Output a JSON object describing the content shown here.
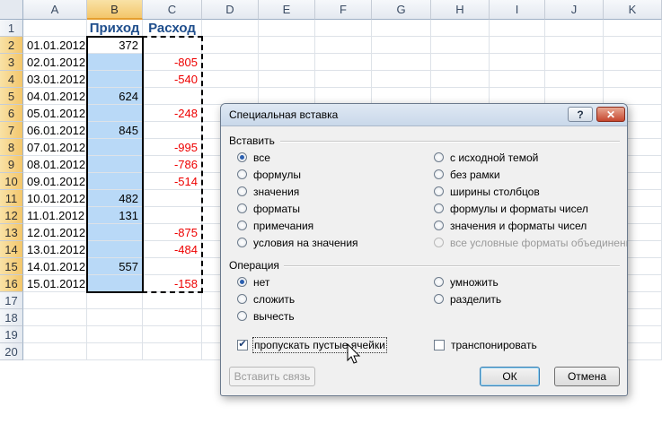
{
  "columns": [
    "A",
    "B",
    "C",
    "D",
    "E",
    "F",
    "G",
    "H",
    "I",
    "J",
    "K"
  ],
  "rows": [
    "1",
    "2",
    "3",
    "4",
    "5",
    "6",
    "7",
    "8",
    "9",
    "10",
    "11",
    "12",
    "13",
    "14",
    "15",
    "16",
    "17",
    "18",
    "19",
    "20"
  ],
  "headers": {
    "income": "Приход",
    "expense": "Расход"
  },
  "data": [
    {
      "date": "01.01.2012",
      "income": "372",
      "expense": ""
    },
    {
      "date": "02.01.2012",
      "income": "",
      "expense": "-805"
    },
    {
      "date": "03.01.2012",
      "income": "",
      "expense": "-540"
    },
    {
      "date": "04.01.2012",
      "income": "624",
      "expense": ""
    },
    {
      "date": "05.01.2012",
      "income": "",
      "expense": "-248"
    },
    {
      "date": "06.01.2012",
      "income": "845",
      "expense": ""
    },
    {
      "date": "07.01.2012",
      "income": "",
      "expense": "-995"
    },
    {
      "date": "08.01.2012",
      "income": "",
      "expense": "-786"
    },
    {
      "date": "09.01.2012",
      "income": "",
      "expense": "-514"
    },
    {
      "date": "10.01.2012",
      "income": "482",
      "expense": ""
    },
    {
      "date": "11.01.2012",
      "income": "131",
      "expense": ""
    },
    {
      "date": "12.01.2012",
      "income": "",
      "expense": "-875"
    },
    {
      "date": "13.01.2012",
      "income": "",
      "expense": "-484"
    },
    {
      "date": "14.01.2012",
      "income": "557",
      "expense": ""
    },
    {
      "date": "15.01.2012",
      "income": "",
      "expense": "-158"
    }
  ],
  "dialog": {
    "title": "Специальная вставка",
    "help_label": "?",
    "close_label": "✕",
    "paste_section": "Вставить",
    "paste_left": [
      {
        "label": "все",
        "checked": true
      },
      {
        "label": "формулы",
        "checked": false
      },
      {
        "label": "значения",
        "checked": false
      },
      {
        "label": "форматы",
        "checked": false
      },
      {
        "label": "примечания",
        "checked": false
      },
      {
        "label": "условия на значения",
        "checked": false
      }
    ],
    "paste_right": [
      {
        "label": "с исходной темой",
        "disabled": false
      },
      {
        "label": "без рамки",
        "disabled": false
      },
      {
        "label": "ширины столбцов",
        "disabled": false
      },
      {
        "label": "формулы и форматы чисел",
        "disabled": false
      },
      {
        "label": "значения и форматы чисел",
        "disabled": false
      },
      {
        "label": "все условные форматы объединения",
        "disabled": true
      }
    ],
    "operation_section": "Операция",
    "op_left": [
      {
        "label": "нет",
        "checked": true
      },
      {
        "label": "сложить",
        "checked": false
      },
      {
        "label": "вычесть",
        "checked": false
      }
    ],
    "op_right": [
      {
        "label": "умножить"
      },
      {
        "label": "разделить"
      }
    ],
    "skip_blanks": {
      "label": "пропускать пустые ячейки",
      "checked": true
    },
    "transpose": {
      "label": "транспонировать",
      "checked": false
    },
    "paste_link_label": "Вставить связь",
    "ok_label": "ОК",
    "cancel_label": "Отмена"
  }
}
